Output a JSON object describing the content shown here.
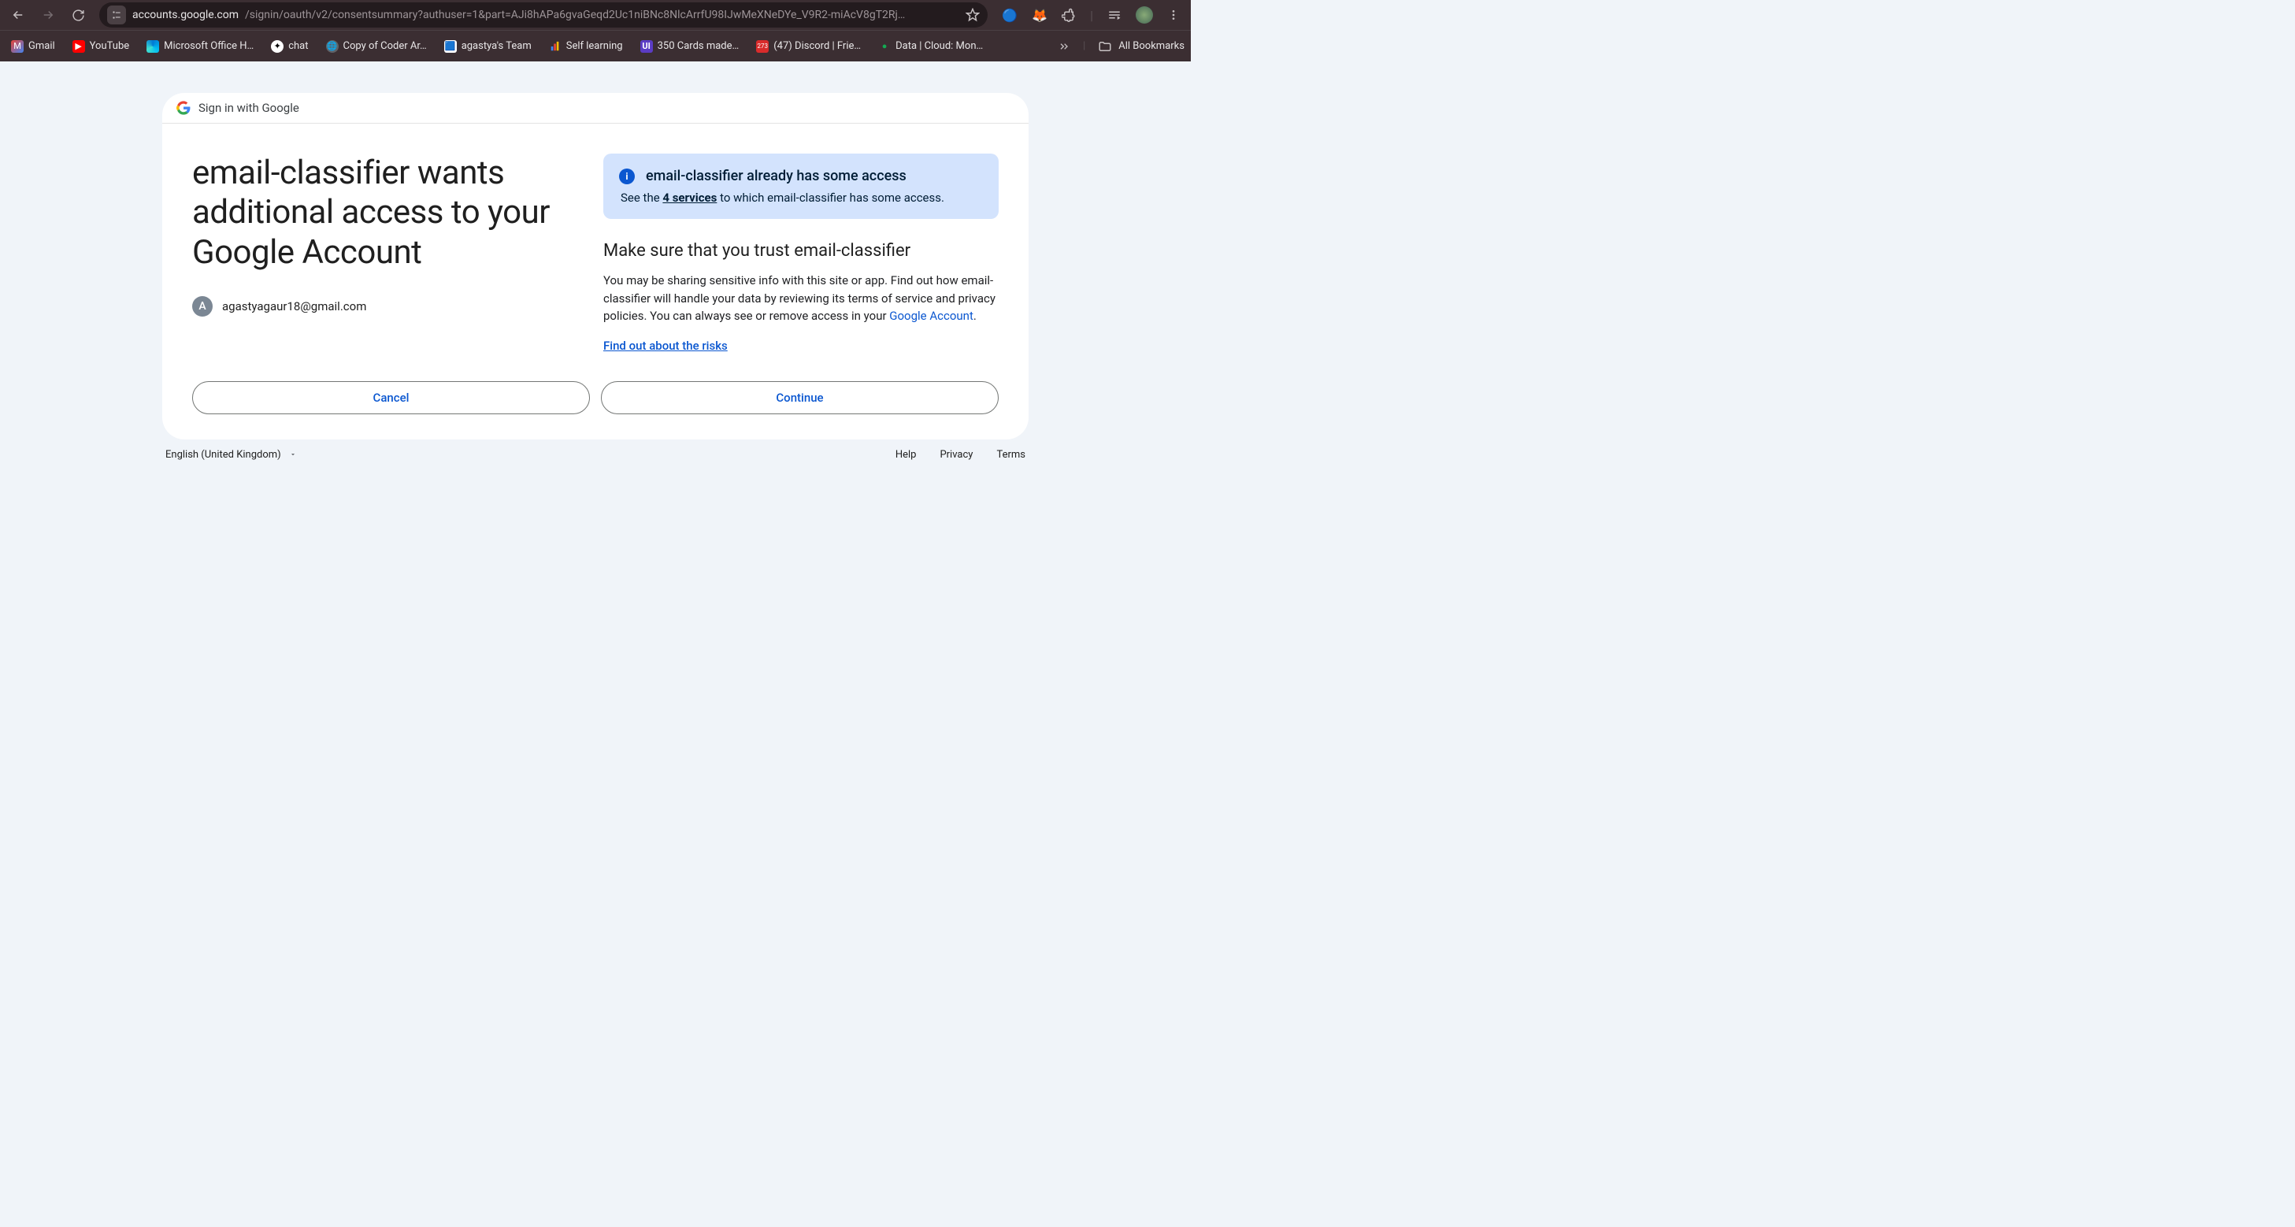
{
  "browser": {
    "url_host": "accounts.google.com",
    "url_path": "/signin/oauth/v2/consentsummary?authuser=1&part=AJi8hAPa6gvaGeqd2Uc1niBNc8NlcArrfU98IJwMeXNeDYe_V9R2-miAcV8gT2Rj…",
    "bookmarks": [
      {
        "label": "Gmail"
      },
      {
        "label": "YouTube"
      },
      {
        "label": "Microsoft Office H…"
      },
      {
        "label": "chat"
      },
      {
        "label": "Copy of Coder Ar…"
      },
      {
        "label": "agastya's Team"
      },
      {
        "label": "Self learning"
      },
      {
        "label": "350 Cards made…"
      },
      {
        "label": "(47) Discord | Frie…"
      },
      {
        "label": "Data | Cloud: Mon…"
      }
    ],
    "all_bookmarks_label": "All Bookmarks"
  },
  "header": {
    "sign_in_text": "Sign in with Google"
  },
  "consent": {
    "heading": "email-classifier wants additional access to your Google Account",
    "avatar_letter": "A",
    "email": "agastyagaur18@gmail.com",
    "info_title": "email-classifier already has some access",
    "info_text_prefix": "See the ",
    "info_link_text": "4 services",
    "info_text_suffix": " to which email-classifier has some access.",
    "trust_heading": "Make sure that you trust email-classifier",
    "trust_text": "You may be sharing sensitive info with this site or app. Find out how email-classifier will handle your data by reviewing its terms of service and privacy policies. You can always see or remove access in your ",
    "google_account_link": "Google Account",
    "trust_text_suffix": ".",
    "risks_link": "Find out about the risks",
    "cancel_label": "Cancel",
    "continue_label": "Continue"
  },
  "footer": {
    "language": "English (United Kingdom)",
    "links": {
      "help": "Help",
      "privacy": "Privacy",
      "terms": "Terms"
    }
  }
}
